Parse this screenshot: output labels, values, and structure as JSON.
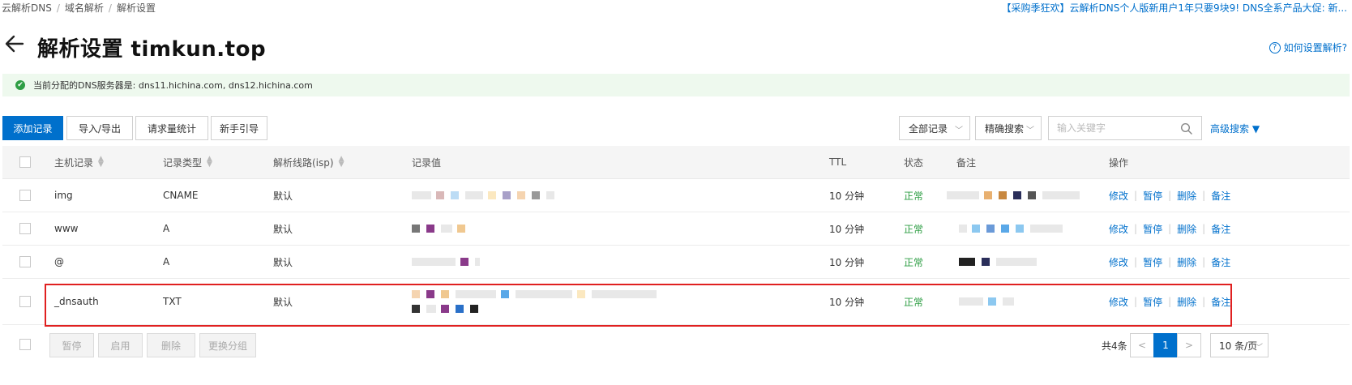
{
  "breadcrumb": {
    "items": [
      "云解析DNS",
      "域名解析",
      "解析设置"
    ]
  },
  "promo": "【采购季狂欢】云解析DNS个人版新用户1年只要9块9! DNS全系产品大促: 新...",
  "header": {
    "title": "解析设置 timkun.top",
    "help_label": "如何设置解析?",
    "help_icon": "?"
  },
  "alert": {
    "icon": "✔",
    "text": "当前分配的DNS服务器是: dns11.hichina.com, dns12.hichina.com"
  },
  "toolbar": {
    "add_record": "添加记录",
    "import_export": "导入/导出",
    "request_stats": "请求量统计",
    "beginner_guide": "新手引导",
    "record_filter": "全部记录",
    "search_mode": "精确搜索",
    "search_placeholder": "输入关键字",
    "advanced_search": "高级搜索 ▼"
  },
  "table": {
    "columns": {
      "host": "主机记录",
      "type": "记录类型",
      "line": "解析线路(isp)",
      "value": "记录值",
      "ttl": "TTL",
      "status": "状态",
      "remark": "备注",
      "actions": "操作"
    },
    "rows": [
      {
        "host": "img",
        "type": "CNAME",
        "line": "默认",
        "ttl": "10 分钟",
        "status": "正常"
      },
      {
        "host": "www",
        "type": "A",
        "line": "默认",
        "ttl": "10 分钟",
        "status": "正常"
      },
      {
        "host": "@",
        "type": "A",
        "line": "默认",
        "ttl": "10 分钟",
        "status": "正常"
      },
      {
        "host": "_dnsauth",
        "type": "TXT",
        "line": "默认",
        "ttl": "10 分钟",
        "status": "正常"
      }
    ],
    "actions": {
      "edit": "修改",
      "pause": "暂停",
      "delete": "删除",
      "remark": "备注"
    }
  },
  "footer": {
    "pause": "暂停",
    "enable": "启用",
    "delete": "删除",
    "change_group": "更换分组",
    "total": "共4条",
    "prev": "<",
    "current_page": "1",
    "next": ">",
    "per_page": "10 条/页"
  },
  "colors": {
    "primary": "#0070cc",
    "success": "#2e9e44",
    "highlight": "#e02020",
    "alert_bg": "#eef9ee"
  }
}
